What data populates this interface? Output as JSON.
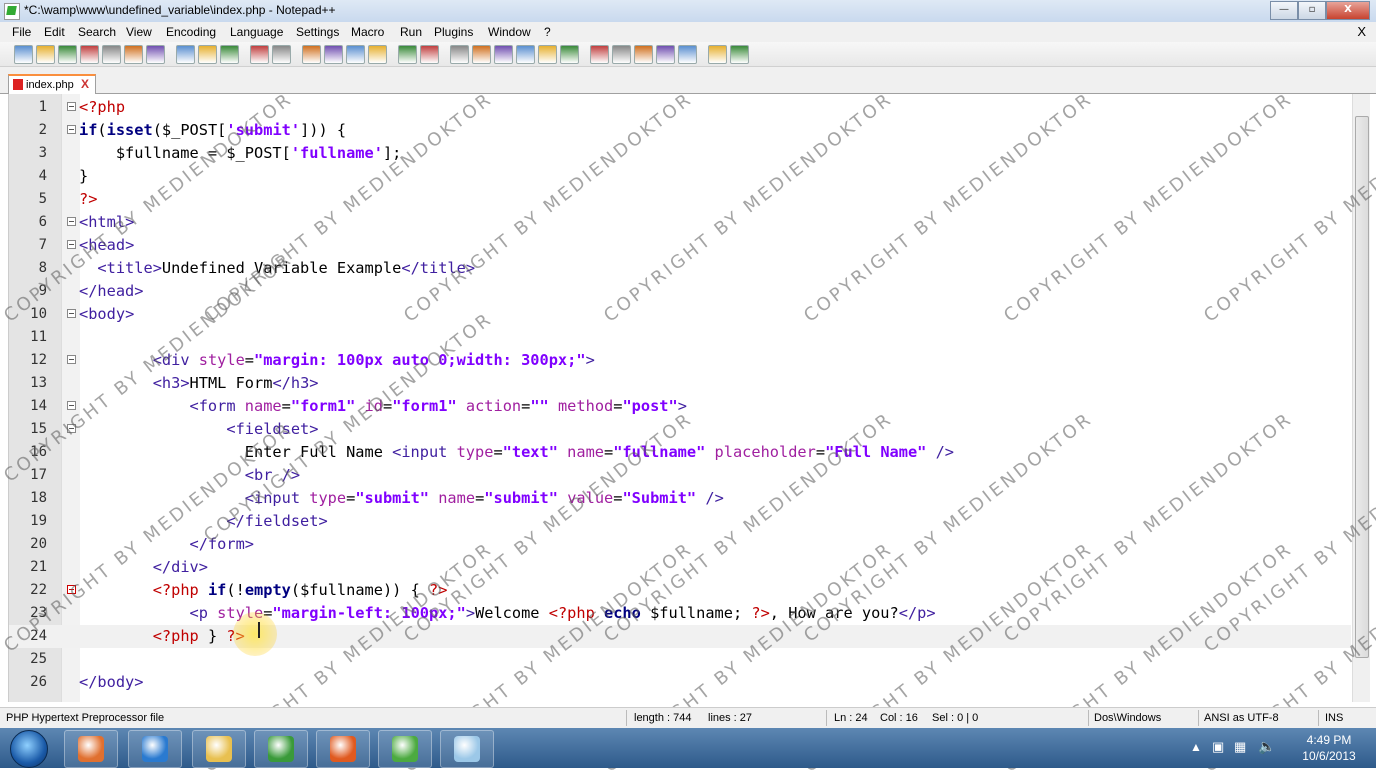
{
  "window": {
    "title": "*C:\\wamp\\www\\undefined_variable\\index.php - Notepad++",
    "controls": {
      "minimize": "—",
      "maximize": "▫",
      "close": "X"
    }
  },
  "menu": [
    "File",
    "Edit",
    "Search",
    "View",
    "Encoding",
    "Language",
    "Settings",
    "Macro",
    "Run",
    "Plugins",
    "Window",
    "?"
  ],
  "menu_close": "X",
  "toolbar_icons": [
    "new-file-icon",
    "open-file-icon",
    "save-icon",
    "save-all-icon",
    "close-icon",
    "close-all-icon",
    "print-icon",
    "cut-icon",
    "copy-icon",
    "paste-icon",
    "undo-icon",
    "redo-icon",
    "find-icon",
    "replace-icon",
    "zoom-in-icon",
    "zoom-out-icon",
    "sync-v-icon",
    "sync-h-icon",
    "word-wrap-icon",
    "show-all-chars-icon",
    "indent-guide-icon",
    "lang-icon",
    "function-list-icon",
    "doc-map-icon",
    "record-macro-icon",
    "stop-macro-icon",
    "play-macro-icon",
    "run-macro-multi-icon",
    "save-macro-icon",
    "ds-plugin-icon",
    "folder-plugin-icon"
  ],
  "tab": {
    "label": "index.php",
    "close": "X"
  },
  "code_lines": [
    {
      "n": "1",
      "text": "<?php",
      "fold": "box"
    },
    {
      "n": "2",
      "text": "if(isset($_POST['submit'])) {",
      "fold": "box"
    },
    {
      "n": "3",
      "text": "    $fullname = $_POST['fullname'];",
      "fold": ""
    },
    {
      "n": "4",
      "text": "}",
      "fold": "end"
    },
    {
      "n": "5",
      "text": "?>",
      "fold": "end"
    },
    {
      "n": "6",
      "text": "<html>",
      "fold": "box"
    },
    {
      "n": "7",
      "text": "<head>",
      "fold": "box"
    },
    {
      "n": "8",
      "text": "  <title>Undefined Variable Example</title>",
      "fold": ""
    },
    {
      "n": "9",
      "text": "</head>",
      "fold": "end"
    },
    {
      "n": "10",
      "text": "<body>",
      "fold": "box"
    },
    {
      "n": "11",
      "text": "",
      "fold": ""
    },
    {
      "n": "12",
      "text": "        <div style=\"margin: 100px auto 0;width: 300px;\">",
      "fold": "box"
    },
    {
      "n": "13",
      "text": "        <h3>HTML Form</h3>",
      "fold": ""
    },
    {
      "n": "14",
      "text": "            <form name=\"form1\" id=\"form1\" action=\"\" method=\"post\">",
      "fold": "box"
    },
    {
      "n": "15",
      "text": "                <fieldset>",
      "fold": "box"
    },
    {
      "n": "16",
      "text": "                  Enter Full Name <input type=\"text\" name=\"fullname\" placeholder=\"Full Name\" />",
      "fold": ""
    },
    {
      "n": "17",
      "text": "                  <br />",
      "fold": ""
    },
    {
      "n": "18",
      "text": "                  <input type=\"submit\" name=\"submit\" value=\"Submit\" />",
      "fold": ""
    },
    {
      "n": "19",
      "text": "                </fieldset>",
      "fold": "end"
    },
    {
      "n": "20",
      "text": "            </form>",
      "fold": "end"
    },
    {
      "n": "21",
      "text": "        </div>",
      "fold": "end"
    },
    {
      "n": "22",
      "text": "        <?php if(!empty($fullname)) { ?>",
      "fold": "redbox"
    },
    {
      "n": "23",
      "text": "            <p style=\"margin-left: 100px;\">Welcome <?php echo $fullname; ?>, How are you?</p>",
      "fold": "red"
    },
    {
      "n": "24",
      "text": "        <?php } ?>",
      "fold": "redend"
    },
    {
      "n": "25",
      "text": "",
      "fold": ""
    },
    {
      "n": "26",
      "text": "</body>",
      "fold": "end"
    }
  ],
  "current_line": 24,
  "status": {
    "filetype": "PHP Hypertext Preprocessor file",
    "length": "length : 744",
    "lines": "lines : 27",
    "ln": "Ln : 24",
    "col": "Col : 16",
    "sel": "Sel : 0 | 0",
    "eol": "Dos\\Windows",
    "encoding": "ANSI as UTF-8",
    "mode": "INS"
  },
  "watermark": "COPYRIGHT BY MEDIENDOKTOR",
  "taskbar": {
    "apps": [
      "media-player-icon",
      "internet-explorer-icon",
      "file-explorer-icon",
      "chrome-icon",
      "firefox-icon",
      "notepad-plus-plus-icon",
      "notepad-icon"
    ],
    "time": "4:49 PM",
    "date": "10/6/2013"
  },
  "colors": {
    "keyword": "#000080",
    "php_tag": "#c00000",
    "tag": "#4020a0",
    "attr": "#a020a0",
    "string": "#8000ff",
    "plain": "#000000"
  }
}
